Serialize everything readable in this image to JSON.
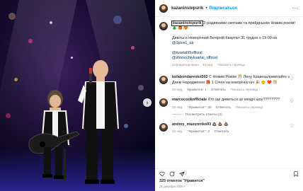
{
  "post": {
    "author": "kazaninstepurik",
    "separator": "•",
    "follow_label": "Подписаться",
    "more_label": "···",
    "caption": {
      "username": "kazaninstepurik",
      "line1": "З різдвяними святами та прийдешнім Новим роком! 🎄 🎁 😍",
      "line2": "Дивіться Новорічний Вечірній Квартал 31 грудня о 19:00 на",
      "link_channel": "@1plus1_ua",
      "link_kvartal": "@kvartal95official",
      "link_zhon": "@zhonochiykvartal_official",
      "edited": "Отредактировано",
      "time": "33 нед.",
      "translate": "Показать перевод"
    }
  },
  "comments": [
    {
      "username": "kolabondarenko502",
      "text": "С Новим Роком 🎊 Лену Кравецьпривітайте з Днем Народження 🎁 1 Січня на новорічну ніч 🎉 😊 ❤️ 🎊",
      "time": "33 нед.",
      "likes": "Нравится: 1",
      "reply": "Ответить",
      "translate": "Показать перевод"
    },
    {
      "username": "marcocookofficiale",
      "text": "Хто ще дивиться це мінідч шоу????????",
      "time": "33 нед.",
      "likes": "\"Нравится\": 20",
      "reply": "Ответить",
      "translate": "Показать перевод",
      "view_replies": "Посмотреть ответы (2)"
    },
    {
      "username": "andrey_mazurenko93",
      "text": "💩 💩 💩",
      "time": "33 нед.",
      "likes": "\"Нравится\": 2",
      "reply": "Ответить"
    }
  ],
  "footer": {
    "likes": "325 отметок \"Нравится\"",
    "date": "31 декабря 2025 г."
  },
  "media": {
    "next_arrow": "›"
  },
  "colors": {
    "link": "#00376b",
    "follow": "#0095f6",
    "muted": "#8e8e8e",
    "stage_bg": "#1a0d35"
  }
}
